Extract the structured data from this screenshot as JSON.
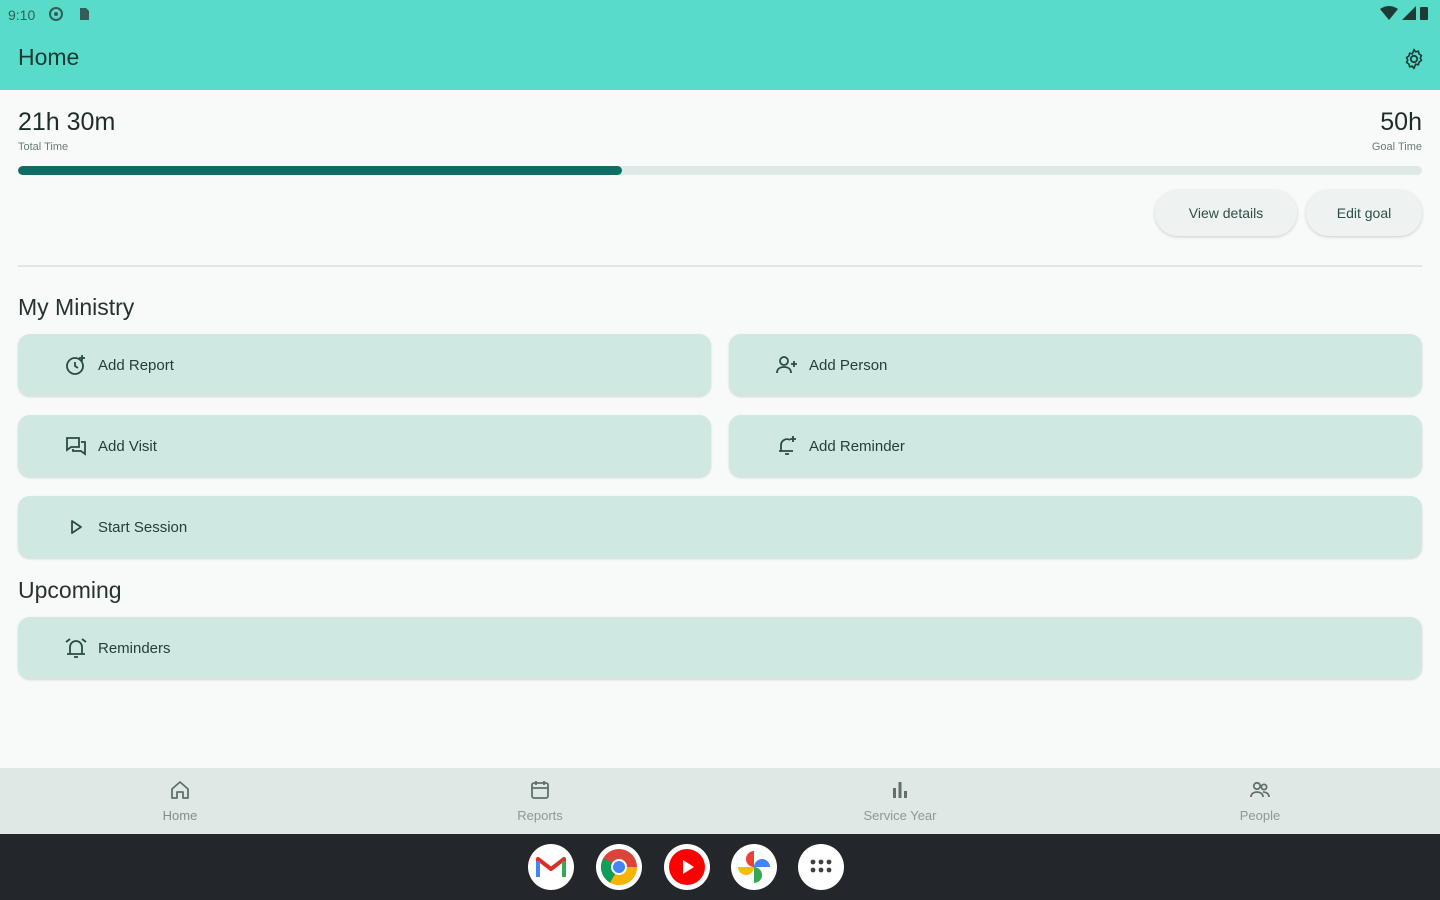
{
  "status_bar": {
    "time": "9:10"
  },
  "app_bar": {
    "title": "Home"
  },
  "stats": {
    "total_value": "21h 30m",
    "total_label": "Total Time",
    "goal_value": "50h",
    "goal_label": "Goal Time",
    "progress_fraction": 0.43
  },
  "actions": {
    "view_details": "View details",
    "edit_goal": "Edit goal"
  },
  "my_ministry": {
    "title": "My Ministry",
    "add_report": "Add Report",
    "add_person": "Add Person",
    "add_visit": "Add Visit",
    "add_reminder": "Add Reminder",
    "start_session": "Start Session"
  },
  "upcoming": {
    "title": "Upcoming",
    "reminders": "Reminders"
  },
  "bottom_nav": [
    {
      "label": "Home",
      "icon": "home-icon"
    },
    {
      "label": "Reports",
      "icon": "calendar-icon"
    },
    {
      "label": "Service Year",
      "icon": "bar-chart-icon"
    },
    {
      "label": "People",
      "icon": "people-icon"
    }
  ],
  "dock_apps": [
    "gmail-icon",
    "chrome-icon",
    "youtube-icon",
    "photos-icon",
    "app-drawer-icon"
  ],
  "colors": {
    "app_bar": "#58dbc9",
    "card": "#cfe8e2",
    "progress": "#0e6e63"
  }
}
